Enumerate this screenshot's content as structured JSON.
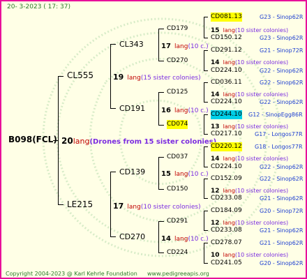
{
  "date": "20-  3-2023 ( 17: 37)",
  "footer": {
    "copyright": "Copyright 2004-2023 @ Karl Kehrle Foundation",
    "site": "www.pedigreeapis.org"
  },
  "colors": {
    "border": "#e8109a",
    "background": "#ffffe6",
    "lang_red": "#c00000",
    "colonies_purple": "#7a2be0",
    "ancestry_blue": "#1a3cd0",
    "green": "#2a7a2a"
  },
  "root": {
    "name": "B098(FCL)",
    "num": "20",
    "lang": "lang",
    "colonies": "(Drones from 15 sister colonies)"
  },
  "gen1": [
    {
      "name": "CL555",
      "num": "19",
      "lang": "lang",
      "colonies": "(15 sister colonies)"
    },
    {
      "name": "LE215",
      "num": "17",
      "lang": "lang",
      "colonies": "(10 sister colonies)"
    }
  ],
  "gen2": [
    {
      "name": "CL343",
      "num": "17",
      "lang": "lang",
      "colonies": "(10 c.)"
    },
    {
      "name": "CD191",
      "num": "16",
      "lang": "lang",
      "colonies": "(10 c.)"
    },
    {
      "name": "CD139",
      "num": "15",
      "lang": "lang",
      "colonies": "(10 c.)"
    },
    {
      "name": "CD270",
      "num": "14",
      "lang": "lang",
      "colonies": "(10 c.)"
    }
  ],
  "gen3": [
    {
      "name": "CD179",
      "num": "15",
      "lang": "lang",
      "colonies": "(10 sister colonies)"
    },
    {
      "name": "CD270",
      "num": "14",
      "lang": "lang",
      "colonies": "(10 sister colonies)"
    },
    {
      "name": "CD125",
      "num": "14",
      "lang": "lang",
      "colonies": "(10 sister colonies)"
    },
    {
      "name": "CD074",
      "num": "13",
      "lang": "lang",
      "colonies": "(10 sister colonies)"
    },
    {
      "name": "CD037",
      "num": "14",
      "lang": "lang",
      "colonies": "(10 sister colonies)"
    },
    {
      "name": "CD150",
      "num": "12",
      "lang": "lang",
      "colonies": "(10 sister colonies)"
    },
    {
      "name": "CD291",
      "num": "12",
      "lang": "lang",
      "colonies": "(10 sister colonies)"
    },
    {
      "name": "CD224",
      "num": "10",
      "lang": "lang",
      "colonies": "(10 sister colonies)"
    }
  ],
  "gen4": [
    {
      "name": "CD081.13",
      "origin": "G23 - Sinop62R"
    },
    {
      "name": "CD150.12",
      "origin": "G23 - Sinop62R"
    },
    {
      "name": "CD291.12",
      "origin": "G21 - Sinop72R"
    },
    {
      "name": "CD224.10",
      "origin": "G22 - Sinop62R"
    },
    {
      "name": "CD036.11",
      "origin": "G22 - Sinop62R"
    },
    {
      "name": "CD224.10",
      "origin": "G22 - Sinop62R"
    },
    {
      "name": "CD244.10",
      "origin": "G12 - SinopEgg86R"
    },
    {
      "name": "CD217.10",
      "origin": "G17 - Longos77R"
    },
    {
      "name": "CD220.12",
      "origin": "G18 - Longos77R"
    },
    {
      "name": "CD224.10",
      "origin": "G22 - Sinop62R"
    },
    {
      "name": "CD152.09",
      "origin": "G22 - Sinop62R"
    },
    {
      "name": "CD233.08",
      "origin": "G21 - Sinop62R"
    },
    {
      "name": "CD184.09",
      "origin": "G20 - Sinop72R"
    },
    {
      "name": "CD233.08",
      "origin": "G21 - Sinop62R"
    },
    {
      "name": "CD278.07",
      "origin": "G21 - Sinop62R"
    },
    {
      "name": "CD241.05",
      "origin": "G20 - Sinop62R"
    }
  ]
}
